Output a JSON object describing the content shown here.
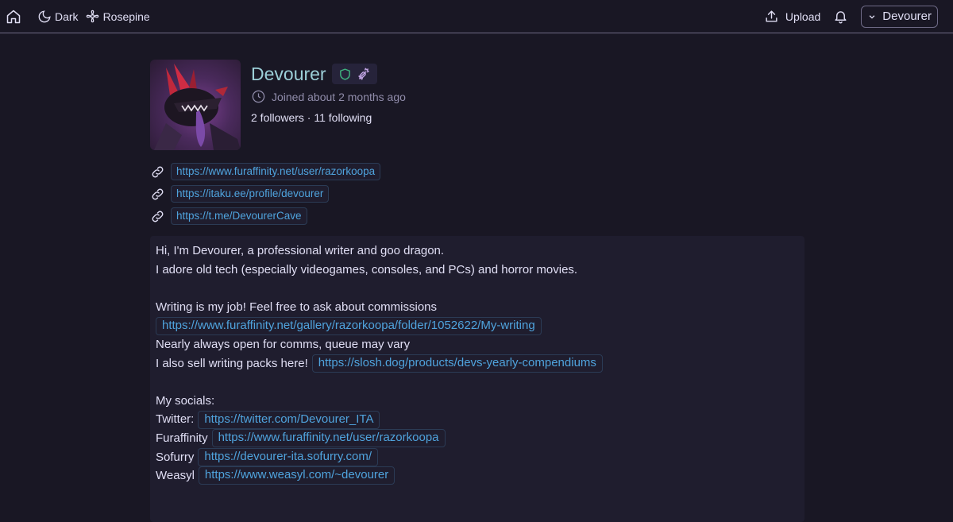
{
  "topbar": {
    "home_icon": "home-icon",
    "dark_label": "Dark",
    "rosepine_label": "Rosepine",
    "upload_label": "Upload",
    "user_label": "Devourer"
  },
  "profile": {
    "username": "Devourer",
    "joined": "Joined about 2 months ago",
    "follows": "2 followers · 11 following",
    "links": [
      "https://www.furaffinity.net/user/razorkoopa",
      "https://itaku.ee/profile/devourer",
      "https://t.me/DevourerCave"
    ]
  },
  "bio": {
    "l1": "Hi, I'm Devourer, a professional writer and goo dragon.",
    "l2": "I adore old tech (especially videogames, consoles, and PCs) and horror movies.",
    "l4": "Writing is my job! Feel free to ask about commissions",
    "l5_link": "https://www.furaffinity.net/gallery/razorkoopa/folder/1052622/My-writing",
    "l6": "Nearly always open for comms, queue may vary",
    "l7_text": "I also sell writing packs here!",
    "l7_link": "https://slosh.dog/products/devs-yearly-compendiums",
    "l9": "My socials:",
    "twitter_label": "Twitter:",
    "twitter_link": "https://twitter.com/Devourer_ITA",
    "fa_label": "Furaffinity",
    "fa_link": "https://www.furaffinity.net/user/razorkoopa",
    "sofurry_label": "Sofurry",
    "sofurry_link": "https://devourer-ita.sofurry.com/",
    "weasyl_label": "Weasyl",
    "weasyl_link": "https://www.weasyl.com/~devourer"
  },
  "colors": {
    "background": "#191724",
    "username": "#9ccfd8",
    "link": "#4fa3dd",
    "shield_badge": "#3fb37f",
    "candy_badge": "#c4a7e7"
  }
}
